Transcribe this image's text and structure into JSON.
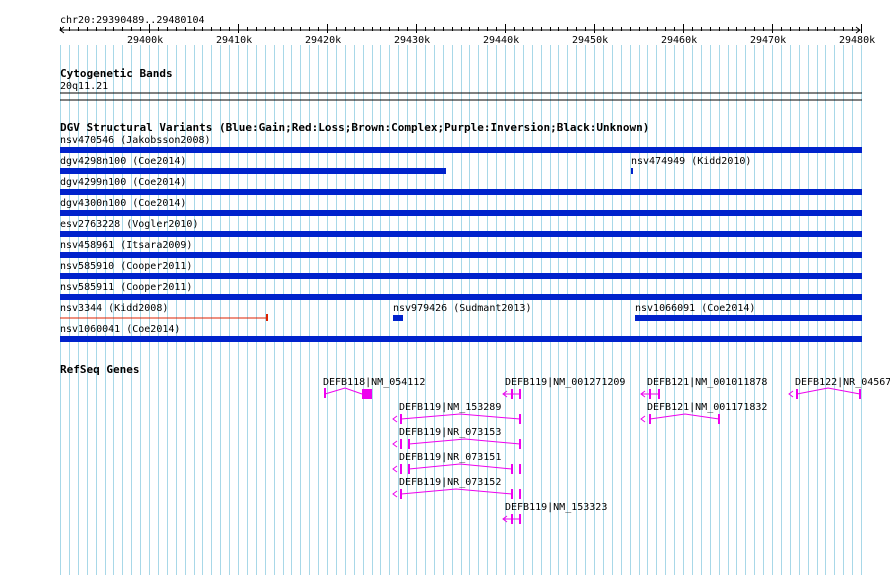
{
  "ruler": {
    "coords": "chr20:29390489..29480104",
    "ticks": [
      "29400k",
      "29410k",
      "29420k",
      "29430k",
      "29440k",
      "29450k",
      "29460k",
      "29470k",
      "29480k"
    ]
  },
  "cytoband": {
    "title": "Cytogenetic Bands",
    "band": "20q11.21"
  },
  "dgv": {
    "title": "DGV Structural Variants (Blue:Gain;Red:Loss;Brown:Complex;Purple:Inversion;Black:Unknown)",
    "features": [
      {
        "label": "nsv470546 (Jakobsson2008)"
      },
      {
        "label": "dgv4298n100 (Coe2014)"
      },
      {
        "label": "nsv474949 (Kidd2010)"
      },
      {
        "label": "dgv4299n100 (Coe2014)"
      },
      {
        "label": "dgv4300n100 (Coe2014)"
      },
      {
        "label": "esv2763228 (Vogler2010)"
      },
      {
        "label": "nsv458961 (Itsara2009)"
      },
      {
        "label": "nsv585910 (Cooper2011)"
      },
      {
        "label": "nsv585911 (Cooper2011)"
      },
      {
        "label": "nsv3344 (Kidd2008)"
      },
      {
        "label": "nsv979426 (Sudmant2013)"
      },
      {
        "label": "nsv1066091 (Coe2014)"
      },
      {
        "label": "nsv1060041 (Coe2014)"
      }
    ]
  },
  "refseq": {
    "title": "RefSeq Genes",
    "genes": [
      {
        "label": "DEFB118|NM_054112"
      },
      {
        "label": "DEFB119|NM_001271209"
      },
      {
        "label": "DEFB121|NM_001011878"
      },
      {
        "label": "DEFB122|NR_04567"
      },
      {
        "label": "DEFB119|NM_153289"
      },
      {
        "label": "DEFB121|NM_001171832"
      },
      {
        "label": "DEFB119|NR_073153"
      },
      {
        "label": "DEFB119|NR_073151"
      },
      {
        "label": "DEFB119|NR_073152"
      },
      {
        "label": "DEFB119|NM_153323"
      }
    ]
  },
  "colors": {
    "grid": "#a8d8e8",
    "gain": "#0022cc",
    "loss": "#dd2200",
    "gene": "#ee00ee"
  }
}
